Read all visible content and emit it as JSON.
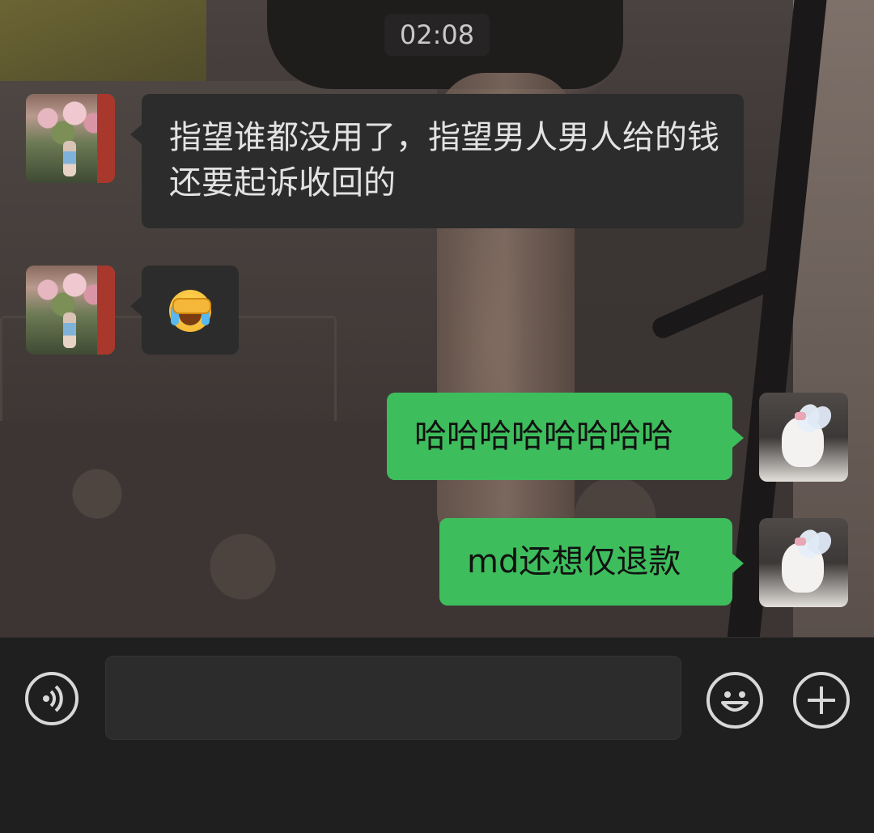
{
  "chat": {
    "timestamp": "02:08",
    "messages": [
      {
        "side": "left",
        "text": "指望谁都没用了，指望男人男人给的钱还要起诉收回的"
      },
      {
        "side": "left",
        "emoji": "face-with-tears-covering-eyes"
      },
      {
        "side": "right",
        "text": "哈哈哈哈哈哈哈哈"
      },
      {
        "side": "right",
        "text": "md还想仅退款"
      }
    ]
  },
  "input_bar": {
    "text_value": "",
    "voice_icon": "voice-icon",
    "emoji_icon": "emoji-icon",
    "more_icon": "plus-icon"
  },
  "colors": {
    "outgoing_bubble": "#3ebd5c",
    "incoming_bubble": "#2c2c2c",
    "bar_background": "#1f1f1f"
  }
}
